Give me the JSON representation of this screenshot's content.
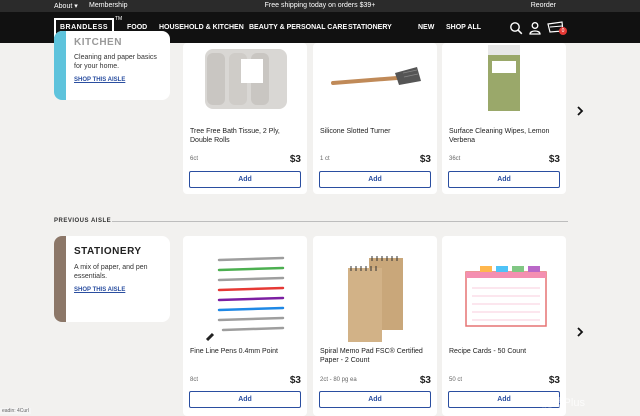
{
  "topbar": {
    "about": "About ▾",
    "membership": "Membership",
    "shipping": "Free shipping today on orders $39+",
    "reorder": "Reorder"
  },
  "nav": {
    "logo": "BRANDLESS",
    "tm": "TM",
    "links": [
      "FOOD",
      "HOUSEHOLD & KITCHEN",
      "BEAUTY & PERSONAL CARE",
      "STATIONERY",
      "NEW",
      "SHOP ALL"
    ],
    "cart_count": "0"
  },
  "aisle_top": {
    "title": "KITCHEN",
    "description": "Cleaning and paper basics for your home.",
    "link": "SHOP THIS AISLE",
    "accent": "#5ec3dc"
  },
  "aisle_bottom": {
    "title": "STATIONERY",
    "description": "A mix of paper, and pen essentials.",
    "link": "SHOP THIS AISLE",
    "accent": "#8c7768"
  },
  "section_label": "PREVIOUS AISLE",
  "products_top": [
    {
      "name": "Tree Free Bath Tissue, 2 Ply, Double Rolls",
      "size": "6ct",
      "price": "$3",
      "add": "Add"
    },
    {
      "name": "Silicone Slotted Turner",
      "size": "1 ct",
      "price": "$3",
      "add": "Add"
    },
    {
      "name": "Surface Cleaning Wipes, Lemon Verbena",
      "size": "36ct",
      "price": "$3",
      "add": "Add"
    }
  ],
  "products_bottom": [
    {
      "name": "Fine Line Pens 0.4mm Point",
      "size": "8ct",
      "price": "$3",
      "add": "Add"
    },
    {
      "name": "Spiral Memo Pad FSC® Certified Paper - 2 Count",
      "size": "2ct - 80 pg ea",
      "price": "$3",
      "add": "Add"
    },
    {
      "name": "Recipe Cards - 50 Count",
      "size": "50 ct",
      "price": "$3",
      "add": "Add"
    }
  ],
  "watermark": "•••能量Plus",
  "status": "eadin: 4Curl"
}
